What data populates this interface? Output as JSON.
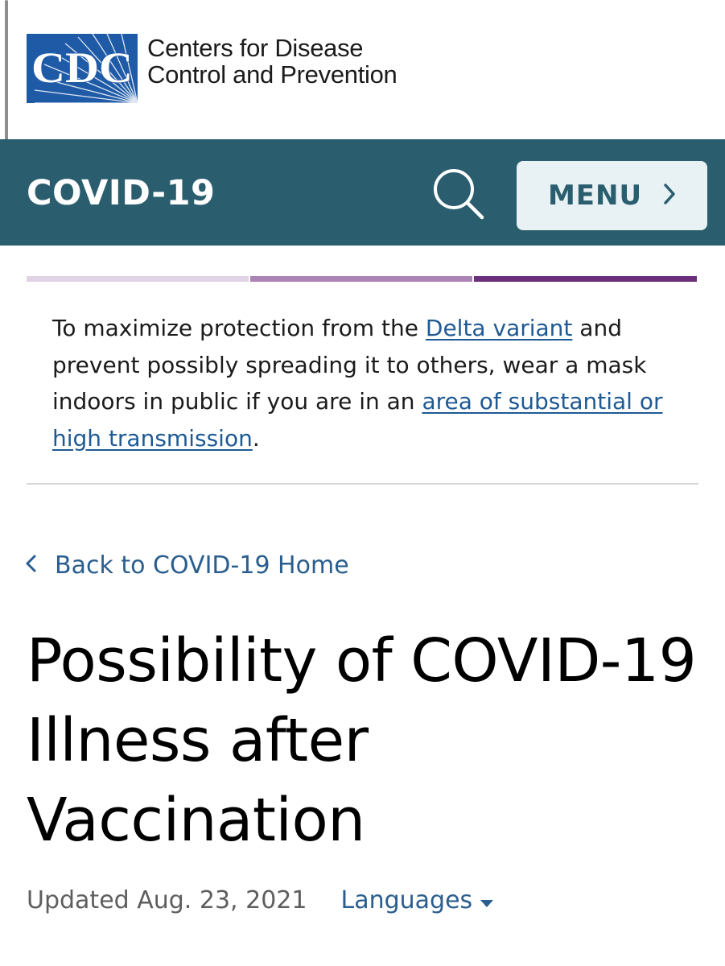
{
  "logo": {
    "mark_text": "CDC",
    "line1": "Centers for Disease",
    "line2": "Control and Prevention",
    "brand_color": "#1f5aa6"
  },
  "topic_bar": {
    "title": "COVID-19",
    "menu_label": "MENU",
    "bar_color": "#2a5e6e",
    "search_icon": "search-icon",
    "menu_icon": "chevron-right-icon"
  },
  "alert": {
    "text_1": "To maximize protection from the ",
    "link_1": "Delta variant",
    "text_2": " and prevent possibly spreading it to others, wear a mask indoors in public if you are in an ",
    "link_2": "area of substantial or high transmission",
    "text_3": "."
  },
  "breadcrumb": {
    "back_label": "Back to COVID-19 Home",
    "icon": "chevron-left-icon"
  },
  "page": {
    "title": "Possibility of COVID-19 Illness after Vaccination",
    "updated": "Updated Aug. 23, 2021",
    "languages_label": "Languages",
    "languages_icon": "caret-down-icon"
  },
  "colors": {
    "link": "#1e5a94",
    "strip_light": "#e1d3e6",
    "strip_mid": "#ab83b4",
    "strip_dark": "#6c2f7c"
  }
}
